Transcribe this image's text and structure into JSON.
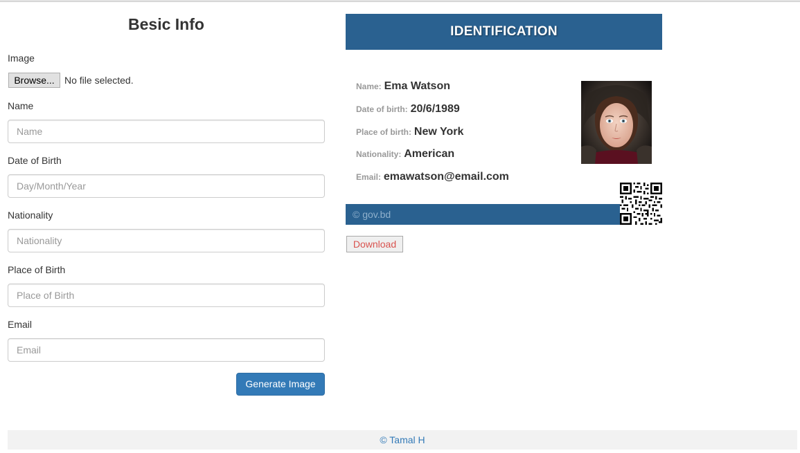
{
  "form": {
    "title": "Besic Info",
    "image_label": "Image",
    "browse_label": "Browse...",
    "file_status": "No file selected.",
    "name_label": "Name",
    "name_placeholder": "Name",
    "dob_label": "Date of Birth",
    "dob_placeholder": "Day/Month/Year",
    "nationality_label": "Nationality",
    "nationality_placeholder": "Nationality",
    "pob_label": "Place of Birth",
    "pob_placeholder": "Place of Birth",
    "email_label": "Email",
    "email_placeholder": "Email",
    "generate_label": "Generate Image"
  },
  "card": {
    "header": "IDENTIFICATION",
    "fields": [
      {
        "key": "Name:",
        "value": "Ema Watson"
      },
      {
        "key": "Date of birth:",
        "value": "20/6/1989"
      },
      {
        "key": "Place of birth:",
        "value": "New York"
      },
      {
        "key": "Nationality:",
        "value": "American"
      },
      {
        "key": "Email:",
        "value": "emawatson@email.com"
      }
    ],
    "footer_text": "© gov.bd",
    "photo_icon": "portrait-photo",
    "qr_icon": "qr-code-icon"
  },
  "actions": {
    "download_label": "Download"
  },
  "footer": {
    "text": "© Tamal H"
  },
  "colors": {
    "card_blue": "#2a6190",
    "primary_button": "#337ab7",
    "download_text": "#d9534f"
  }
}
